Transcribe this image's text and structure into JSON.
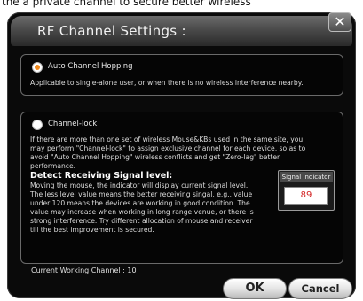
{
  "background_text": "the a private channel to secure better wireless",
  "dialog": {
    "title": "RF Channel Settings :",
    "close_glyph": "✕"
  },
  "auto_hopping": {
    "label": "Auto Channel Hopping",
    "selected": true,
    "description": "Applicable to single-alone user, or when there is no wireless interference nearby."
  },
  "channel_lock": {
    "label": "Channel-lock",
    "selected": false,
    "description_lines": [
      "If there are more than one set of wireless Mouse&KBs used in the same site, you",
      "may perform \"Channel-lock\" to assign exclusive channel for each device, so as to",
      "avoid \"Auto Channel Hopping\" wireless conflicts and get \"Zero-lag\" better",
      "performance."
    ]
  },
  "signal": {
    "heading": "Detect Receiving Signal level:",
    "description_lines": [
      "Moving the mouse, the indicator will display current signal level.",
      "The less level value means the better receiving singal, e.g., value",
      "under 120 means the devices are working in good condition. The",
      "value may increase when working in long range venue, or there is",
      "strong interference. Try different allocation of mouse and receiver",
      "till the best improvement is secured."
    ],
    "indicator_label": "Signal Indicator",
    "indicator_value": "89"
  },
  "status": {
    "current_channel": "Current Working Channel :  10"
  },
  "buttons": {
    "ok": "OK",
    "cancel": "Cancel"
  },
  "colors": {
    "accent_radio": "#f08a1e",
    "signal_value": "#d21f1f"
  }
}
